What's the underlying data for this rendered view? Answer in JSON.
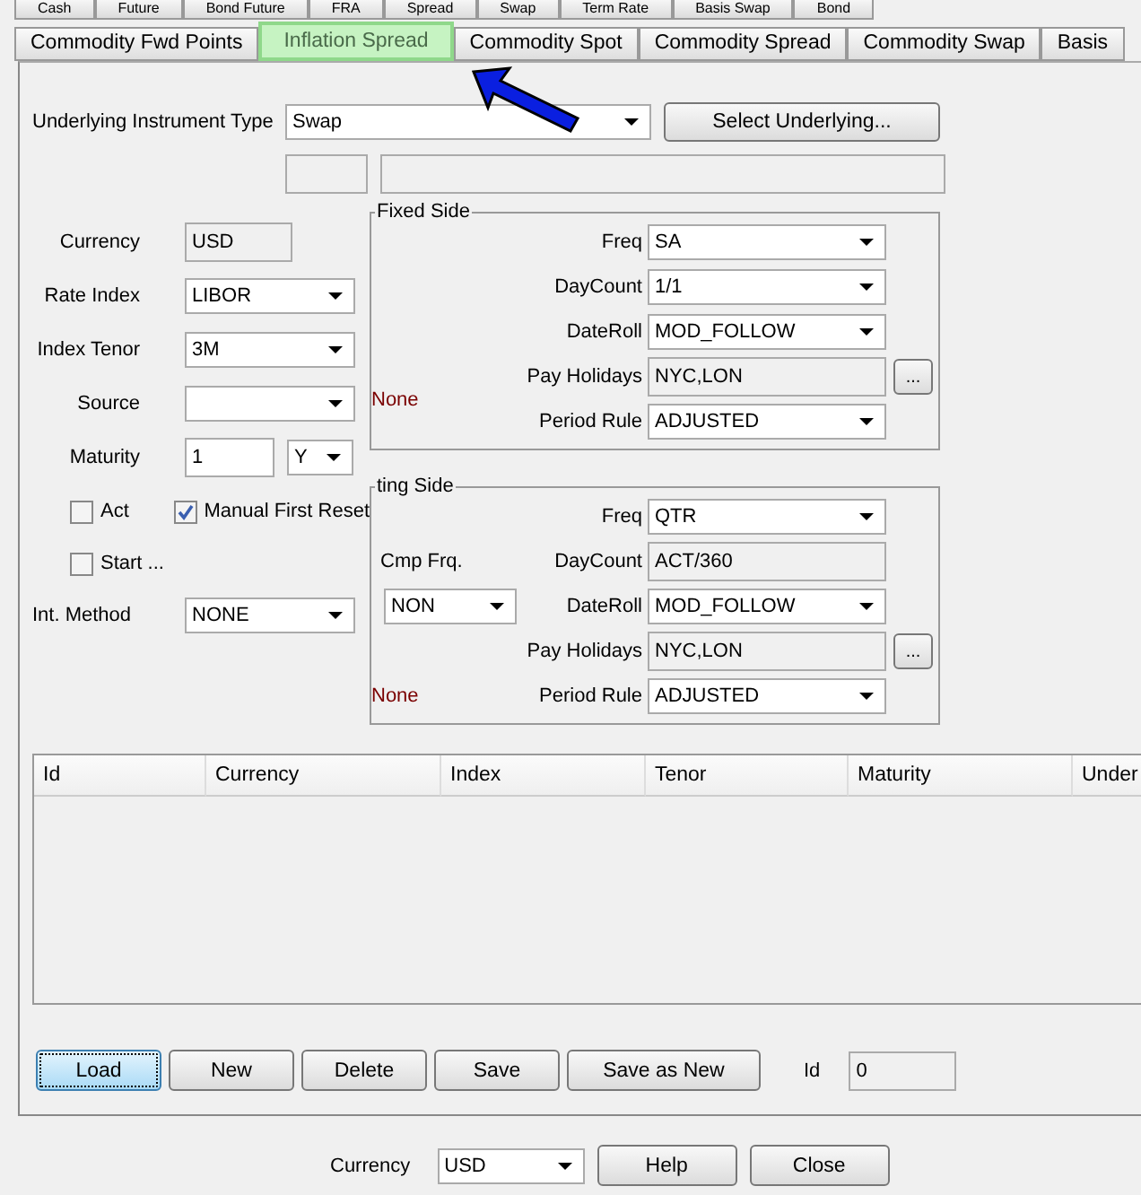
{
  "tabs_row_1": [
    {
      "label": "Cash",
      "selected": false
    },
    {
      "label": "Future",
      "selected": false
    },
    {
      "label": "Bond Future",
      "selected": false
    },
    {
      "label": "FRA",
      "selected": false
    },
    {
      "label": "Spread",
      "selected": false
    },
    {
      "label": "Swap",
      "selected": false
    },
    {
      "label": "Term Rate",
      "selected": false
    },
    {
      "label": "Basis Swap",
      "selected": false
    },
    {
      "label": "Bond",
      "selected": false
    }
  ],
  "tabs": [
    {
      "label": "Commodity Fwd Points",
      "selected": false
    },
    {
      "label": "Inflation Spread",
      "selected": true
    },
    {
      "label": "Commodity Spot",
      "selected": false
    },
    {
      "label": "Commodity Spread",
      "selected": false
    },
    {
      "label": "Commodity Swap",
      "selected": false
    },
    {
      "label": "Basis",
      "selected": false
    }
  ],
  "instrument": {
    "label": "Underlying Instrument Type",
    "value": "Swap",
    "button": "Select Underlying..."
  },
  "left_fields": [
    {
      "label": "Currency",
      "kind": "readonly",
      "value": "USD"
    },
    {
      "label": "Rate Index",
      "kind": "select",
      "value": "LIBOR"
    },
    {
      "label": "Index Tenor",
      "kind": "select",
      "value": "3M"
    },
    {
      "label": "Source",
      "kind": "select"
    }
  ],
  "maturity": {
    "label": "Maturity",
    "value": "1",
    "unit": "Y"
  },
  "checkboxes": [
    {
      "label": "Act",
      "checked": false
    },
    {
      "label": "Manual First Reset",
      "checked": true
    },
    {
      "label": "Start ...",
      "checked": false
    }
  ],
  "int_method": {
    "label": "Int. Method",
    "value": "NONE"
  },
  "fixed_side": {
    "title": "Fixed Side",
    "note": "None",
    "rows": [
      {
        "label": "Freq",
        "kind": "select",
        "value": "SA"
      },
      {
        "label": "DayCount",
        "kind": "select",
        "value": "1/1"
      },
      {
        "label": "DateRoll",
        "kind": "select",
        "value": "MOD_FOLLOW"
      },
      {
        "label": "Pay Holidays",
        "kind": "picker",
        "value": "NYC,LON",
        "button": "..."
      },
      {
        "label": "Period Rule",
        "kind": "select",
        "value": "ADJUSTED"
      }
    ]
  },
  "floating_side": {
    "title": "ting Side",
    "compounding": {
      "label": "Cmp Frq.",
      "value": "NON"
    },
    "note": "None",
    "rows": [
      {
        "label": "Freq",
        "kind": "select",
        "value": "QTR"
      },
      {
        "label": "DayCount",
        "kind": "readonly",
        "value": "ACT/360"
      },
      {
        "label": "DateRoll",
        "kind": "select",
        "value": "MOD_FOLLOW"
      },
      {
        "label": "Pay Holidays",
        "kind": "picker",
        "value": "NYC,LON",
        "button": "..."
      },
      {
        "label": "Period Rule",
        "kind": "select",
        "value": "ADJUSTED"
      }
    ]
  },
  "table": {
    "columns": [
      "Id",
      "Currency",
      "Index",
      "Tenor",
      "Maturity",
      "Under"
    ]
  },
  "actions": [
    {
      "label": "Load",
      "focused": true
    },
    {
      "label": "New",
      "focused": false
    },
    {
      "label": "Delete",
      "focused": false
    },
    {
      "label": "Save",
      "focused": false
    },
    {
      "label": "Save as New",
      "focused": false
    }
  ],
  "id_field": {
    "label": "Id",
    "value": "0"
  },
  "footer": {
    "currency_label": "Currency",
    "currency_value": "USD",
    "buttons": [
      "Help",
      "Close"
    ]
  }
}
